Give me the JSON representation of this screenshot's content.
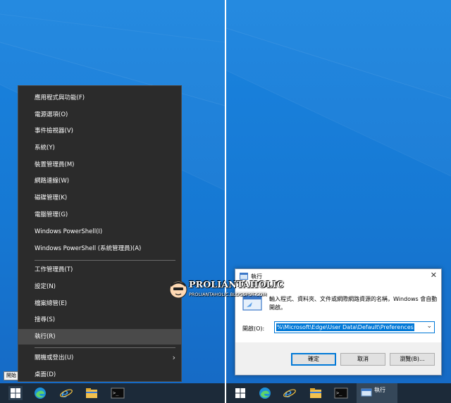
{
  "winx_menu": {
    "items": [
      {
        "label": "應用程式與功能(F)"
      },
      {
        "label": "電源選項(O)"
      },
      {
        "label": "事件檢視器(V)"
      },
      {
        "label": "系統(Y)"
      },
      {
        "label": "裝置管理員(M)"
      },
      {
        "label": "網路連線(W)"
      },
      {
        "label": "磁碟管理(K)"
      },
      {
        "label": "電腦管理(G)"
      },
      {
        "label": "Windows PowerShell(I)"
      },
      {
        "label": "Windows PowerShell (系統管理員)(A)"
      },
      {
        "label": "工作管理員(T)"
      },
      {
        "label": "設定(N)"
      },
      {
        "label": "檔案總管(E)"
      },
      {
        "label": "搜尋(S)"
      },
      {
        "label": "執行(R)"
      },
      {
        "label": "關機或登出(U)"
      },
      {
        "label": "桌面(D)"
      }
    ],
    "selected": "執行(R)"
  },
  "start_tooltip": "開始",
  "run_dialog": {
    "title": "執行",
    "description": "輸入程式、資料夾、文件或網際網路資源的名稱，Windows 會自動開啟。",
    "open_label": "開啟(O):",
    "input_value": "%\\Microsoft\\Edge\\User Data\\Default\\Preferences",
    "ok_label": "確定",
    "cancel_label": "取消",
    "browse_label": "瀏覽(B)..."
  },
  "watermark": {
    "title": "PROLIANTAHOLIC",
    "url": "PROLIANTAHOLIC.BLOGSPOT.COM"
  },
  "taskbar_right": {
    "active_label": "執行"
  },
  "icons": [
    "windows-logo-icon",
    "edge-icon",
    "ie-icon",
    "file-explorer-icon",
    "cmd-icon",
    "run-icon",
    "close-icon",
    "chevron-right-icon",
    "chevron-down-icon"
  ],
  "colors": {
    "desktop": "#1678d3",
    "taskbar": "#1c2a39",
    "menu_bg": "#2b2b2b",
    "menu_selected": "#4a4a4a",
    "accent": "#0078d7"
  }
}
